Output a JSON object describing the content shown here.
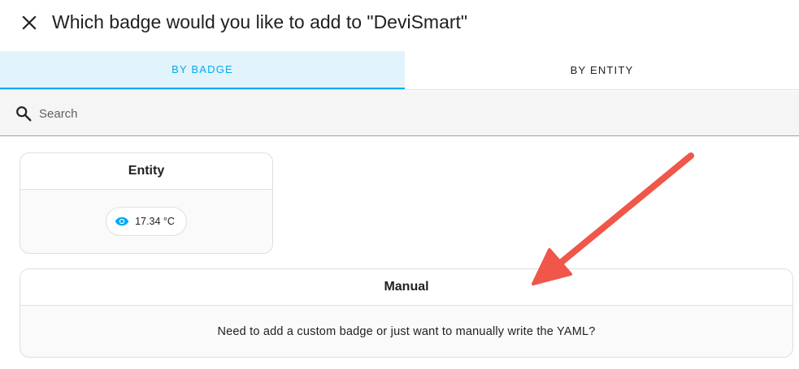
{
  "dialog": {
    "title": "Which badge would you like to add to \"DeviSmart\""
  },
  "tabs": [
    {
      "label": "BY BADGE",
      "active": true
    },
    {
      "label": "BY ENTITY",
      "active": false
    }
  ],
  "search": {
    "placeholder": "Search",
    "value": ""
  },
  "cards": {
    "entity": {
      "title": "Entity",
      "badge_value": "17.34 °C",
      "badge_icon": "eye-icon"
    },
    "manual": {
      "title": "Manual",
      "description": "Need to add a custom badge or just want to manually write the YAML?"
    }
  },
  "colors": {
    "accent": "#03a9f4",
    "active_tab_bg": "#e1f4fb",
    "annotation_arrow": "#f0564a"
  }
}
